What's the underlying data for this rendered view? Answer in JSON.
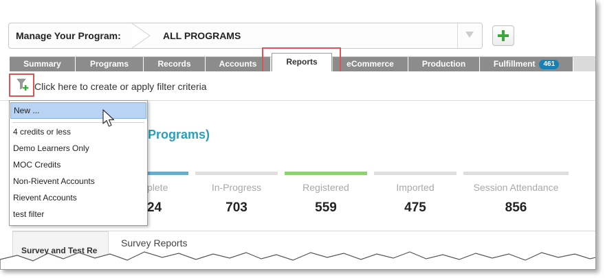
{
  "header": {
    "manage_label": "Manage Your Program:",
    "program_value": "ALL PROGRAMS"
  },
  "tabs": [
    {
      "label": "Summary"
    },
    {
      "label": "Programs"
    },
    {
      "label": "Records"
    },
    {
      "label": "Accounts"
    },
    {
      "label": "Reports",
      "active": true
    },
    {
      "label": "eCommerce"
    },
    {
      "label": "Production"
    },
    {
      "label": "Fulfillment",
      "badge": "461"
    }
  ],
  "filter": {
    "text": "Click here to create or apply filter criteria"
  },
  "dropdown": {
    "new_item": "New ...",
    "items": [
      "4 credits or less",
      "Demo Learners Only",
      "MOC Credits",
      "Non-Rievent Accounts",
      "Rievent Accounts",
      "test filter"
    ]
  },
  "heading_partial": "Programs)",
  "stats": [
    {
      "label": "plete",
      "value": "24"
    },
    {
      "label": "In-Progress",
      "value": "703"
    },
    {
      "label": "Registered",
      "value": "559"
    },
    {
      "label": "Imported",
      "value": "475"
    },
    {
      "label": "Session Attendance",
      "value": "856"
    }
  ],
  "bottom": {
    "left_tab_label": "Survey and Test Re",
    "survey_label": "Survey Reports"
  },
  "colors": {
    "accent": "#2aa0b8",
    "stat_blue": "#6aaccc",
    "stat_green": "#8ed174",
    "stat_gray": "#dedede",
    "highlight": "#e05252",
    "badge": "#1a7fb4"
  }
}
